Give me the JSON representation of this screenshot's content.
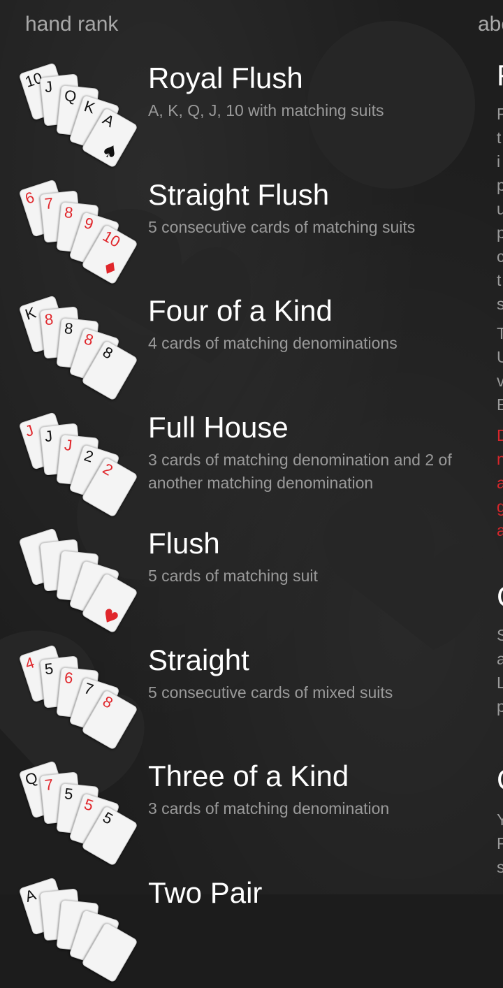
{
  "header": {
    "pivot_active": "hand rank",
    "pivot_next": "abo"
  },
  "hands": [
    {
      "title": "Royal Flush",
      "desc": "A, K, Q, J, 10 with matching suits",
      "cards": [
        [
          "10",
          "♠",
          "blk"
        ],
        [
          "J",
          "♠",
          "blk"
        ],
        [
          "Q",
          "♠",
          "blk"
        ],
        [
          "K",
          "♠",
          "blk"
        ],
        [
          "A",
          "♠",
          "blk"
        ]
      ]
    },
    {
      "title": "Straight Flush",
      "desc": "5 consecutive cards of matching suits",
      "cards": [
        [
          "6",
          "♦",
          "red"
        ],
        [
          "7",
          "♦",
          "red"
        ],
        [
          "8",
          "♦",
          "red"
        ],
        [
          "9",
          "♦",
          "red"
        ],
        [
          "10",
          "♦",
          "red"
        ]
      ]
    },
    {
      "title": "Four of a Kind",
      "desc": "4 cards of matching denominations",
      "cards": [
        [
          "K",
          "",
          "blk"
        ],
        [
          "8",
          "",
          "red"
        ],
        [
          "8",
          "",
          "blk"
        ],
        [
          "8",
          "",
          "red"
        ],
        [
          "8",
          "",
          "blk"
        ]
      ]
    },
    {
      "title": "Full House",
      "desc": "3 cards of matching denomination and 2 of another matching denomination",
      "cards": [
        [
          "J",
          "",
          "red"
        ],
        [
          "J",
          "",
          "blk"
        ],
        [
          "J",
          "",
          "red"
        ],
        [
          "2",
          "",
          "blk"
        ],
        [
          "2",
          "",
          "red"
        ]
      ]
    },
    {
      "title": "Flush",
      "desc": "5 cards of matching suit",
      "cards": [
        [
          "",
          "♥",
          "red"
        ],
        [
          "",
          "♥",
          "red"
        ],
        [
          "",
          "♥",
          "red"
        ],
        [
          "",
          "♥",
          "red"
        ],
        [
          "",
          "♥",
          "red"
        ]
      ]
    },
    {
      "title": "Straight",
      "desc": "5 consecutive cards of mixed suits",
      "cards": [
        [
          "4",
          "",
          "red"
        ],
        [
          "5",
          "",
          "blk"
        ],
        [
          "6",
          "",
          "red"
        ],
        [
          "7",
          "",
          "blk"
        ],
        [
          "8",
          "",
          "red"
        ]
      ]
    },
    {
      "title": "Three of a Kind",
      "desc": "3 cards of matching denomination",
      "cards": [
        [
          "Q",
          "",
          "blk"
        ],
        [
          "7",
          "",
          "red"
        ],
        [
          "5",
          "",
          "blk"
        ],
        [
          "5",
          "",
          "red"
        ],
        [
          "5",
          "",
          "blk"
        ]
      ]
    },
    {
      "title": "Two Pair",
      "desc": "",
      "cards": [
        [
          "A",
          "",
          "blk"
        ],
        [
          "",
          "",
          "blk"
        ],
        [
          "",
          "",
          "blk"
        ],
        [
          "",
          "",
          "blk"
        ],
        [
          "",
          "",
          "blk"
        ]
      ]
    }
  ],
  "side_panel": {
    "heading_1": "F",
    "lines_1": [
      "F",
      "t",
      "i",
      "p",
      "u",
      "p",
      "c",
      "t",
      "s"
    ],
    "lines_2": [
      "T",
      "U",
      "v",
      "E"
    ],
    "lines_red": [
      "D",
      "n",
      "a",
      "g",
      "a"
    ],
    "heading_2": "C",
    "lines_3": [
      "S",
      "a",
      "L",
      "p"
    ],
    "heading_3": "C",
    "lines_4": [
      "Y",
      "F",
      "s"
    ]
  },
  "colors": {
    "accent_red": "#e0262b",
    "title": "#ffffff",
    "desc": "#9a9a9a"
  }
}
